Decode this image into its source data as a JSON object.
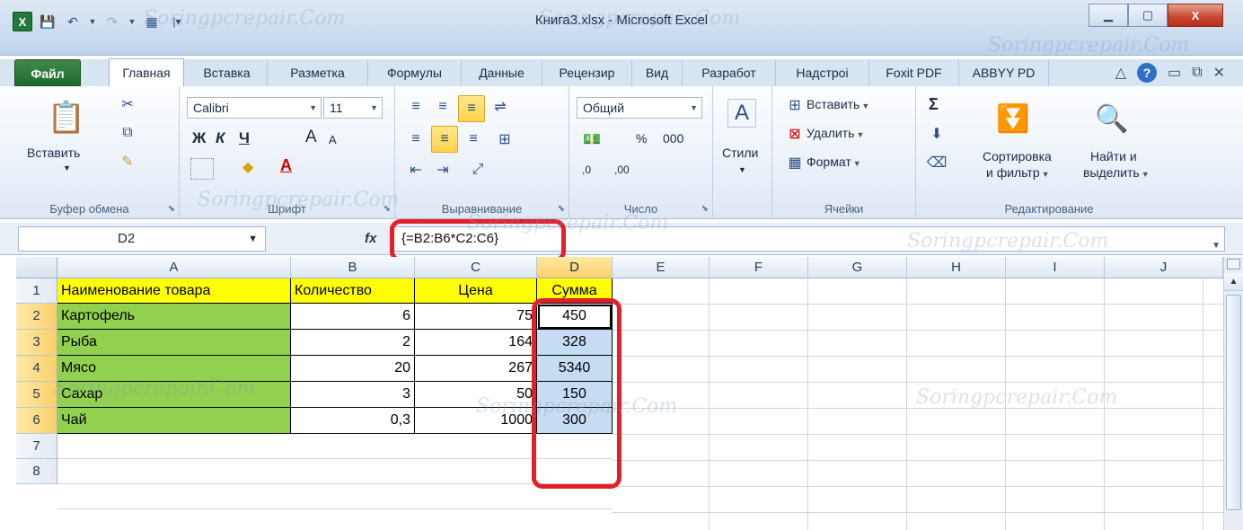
{
  "window": {
    "title": "Книга3.xlsx - Microsoft Excel",
    "app_icon": "excel-x-icon",
    "minimize": "▁",
    "maximize": "▢",
    "close": "X"
  },
  "ribbon_tabs": [
    "Файл",
    "Главная",
    "Вставка",
    "Разметка",
    "Формулы",
    "Данные",
    "Рецензир",
    "Вид",
    "Разработ",
    "Надстроі",
    "Foxit PDF",
    "ABBYY PD"
  ],
  "active_tab": "Главная",
  "groups": {
    "clipboard": {
      "label": "Буфер обмена",
      "paste": "Вставить"
    },
    "font": {
      "label": "Шрифт",
      "font_name": "Calibri",
      "font_size": "11",
      "bold": "Ж",
      "italic": "К",
      "underline": "Ч",
      "grow": "A",
      "shrink": "A",
      "fill": "◆",
      "color": "A"
    },
    "alignment": {
      "label": "Выравнивание"
    },
    "number": {
      "label": "Число",
      "format": "Общий",
      "percent": "%",
      "thousands": "000",
      "inc_dec": ",0",
      "dec_dec": ",00"
    },
    "styles": {
      "label": "Стили"
    },
    "cells": {
      "label": "Ячейки",
      "insert": "Вставить",
      "delete": "Удалить",
      "format": "Формат"
    },
    "editing": {
      "label": "Редактирование",
      "sum": "Σ",
      "sort_line1": "Сортировка",
      "sort_line2": "и фильтр",
      "find_line1": "Найти и",
      "find_line2": "выделить"
    }
  },
  "formula_bar": {
    "name_box": "D2",
    "fx": "fx",
    "formula": "{=B2:B6*C2:C6}"
  },
  "columns": [
    "A",
    "B",
    "C",
    "D",
    "E",
    "F",
    "G",
    "H",
    "I",
    "J"
  ],
  "selected_column": "D",
  "rows": [
    "1",
    "2",
    "3",
    "4",
    "5",
    "6",
    "7",
    "8"
  ],
  "sheet": {
    "header": [
      "Наименование товара",
      "Количество",
      "Цена",
      "Сумма"
    ],
    "data": [
      [
        "Картофель",
        "6",
        "75",
        "450"
      ],
      [
        "Рыба",
        "2",
        "164",
        "328"
      ],
      [
        "Мясо",
        "20",
        "267",
        "5340"
      ],
      [
        "Сахар",
        "3",
        "50",
        "150"
      ],
      [
        "Чай",
        "0,3",
        "1000",
        "300"
      ]
    ]
  },
  "watermark": "Soringpcrepair.Com",
  "colors": {
    "highlight_red": "#e3202a",
    "yellow_fill": "#ffff00",
    "green_fill": "#92d050",
    "selection_blue": "#c6dcf2"
  }
}
